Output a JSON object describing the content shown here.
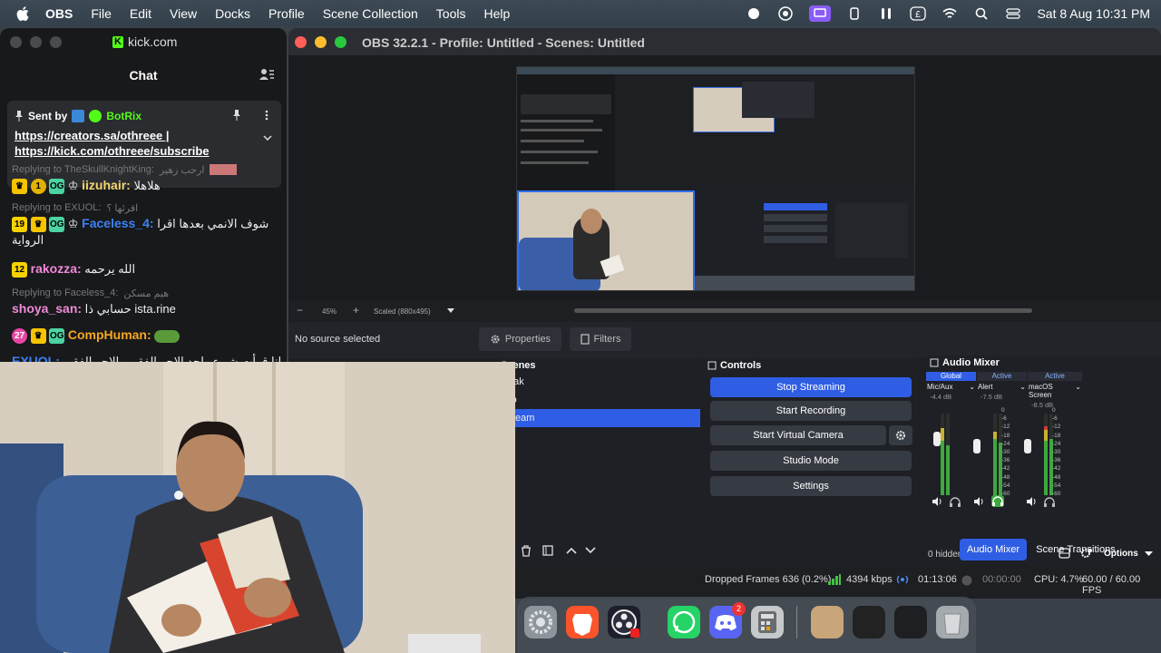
{
  "menubar": {
    "app_name": "OBS",
    "items": [
      "File",
      "Edit",
      "View",
      "Docks",
      "Profile",
      "Scene Collection",
      "Tools",
      "Help"
    ],
    "datetime": "Sat 8 Aug  10:31 PM"
  },
  "chat_window": {
    "url": "kick.com",
    "title": "Chat",
    "pinned": {
      "sent_by_label": "Sent by",
      "sender": "BotRix",
      "link1": "https://creators.sa/othreee |",
      "link2": "https://kick.com/othreee/subscribe"
    },
    "messages": [
      {
        "reply_to": "Replying to TheSkullKnightKing:",
        "reply_text": "ارحب زهير",
        "user": "iizuhair:",
        "text": "هلاهلا"
      },
      {
        "reply_to": "Replying to EXUOL:",
        "reply_text": "اقرئها ؟",
        "badge_num": "19",
        "user": "Faceless_4:",
        "text": "شوف الانمي بعدها اقرا",
        "text2": "الرواية"
      },
      {
        "badge_num": "12",
        "user": "rakozza:",
        "text": "الله يرحمه"
      },
      {
        "reply_to": "Replying to Faceless_4:",
        "reply_text": "هيم مسكن",
        "user": "shoya_san:",
        "text": "حسابي ذا ista.rine"
      },
      {
        "badge_num": "27",
        "user": "CompHuman:",
        "text": ""
      },
      {
        "user": "EXUOL:",
        "text": "انا قرأت شيء واحد الاجر الفقير والاجر الفقير"
      }
    ]
  },
  "obs": {
    "title": "OBS 32.2.1 - Profile: Untitled - Scenes: Untitled",
    "zoom": "45%",
    "scaled": "Scaled (880x495)",
    "no_source": "No source selected",
    "properties": "Properties",
    "filters": "Filters",
    "scenes": {
      "header": "Scenes",
      "items": [
        "eak",
        "ro",
        "eam"
      ]
    },
    "controls": {
      "header": "Controls",
      "stop_streaming": "Stop Streaming",
      "start_recording": "Start Recording",
      "start_virtual_camera": "Start Virtual Camera",
      "studio_mode": "Studio Mode",
      "settings": "Settings"
    },
    "mixer": {
      "header": "Audio Mixer",
      "channels": [
        {
          "tab": "Global",
          "name": "Mic/Aux",
          "db": "-4.4 dB"
        },
        {
          "tab": "Active",
          "name": "Alert",
          "db": "-7.5 dB"
        },
        {
          "tab": "Active",
          "name": "macOS Screen",
          "db": "-8.5 dB"
        }
      ],
      "scale": [
        "0",
        "-6",
        "-12",
        "-18",
        "-24",
        "-30",
        "-36",
        "-42",
        "-48",
        "-54",
        "-60"
      ],
      "hidden": "0 hidden",
      "options": "Options",
      "tab_mixer": "Audio Mixer",
      "tab_transitions": "Scene Transitions"
    },
    "status": {
      "dropped": "Dropped Frames 636 (0.2%)",
      "kbps": "4394 kbps",
      "stream_time": "01:13:06",
      "rec_time": "00:00:00",
      "cpu": "CPU: 4.7%",
      "fps": "60.00 / 60.00 FPS"
    }
  },
  "dock": {
    "whatsapp_badge": "",
    "discord_badge": "2"
  },
  "colors": {
    "accent": "#2f5ee5",
    "kick_green": "#53fc18",
    "close": "#ff5f57",
    "minimize": "#febc2e",
    "zoom": "#28c840"
  }
}
